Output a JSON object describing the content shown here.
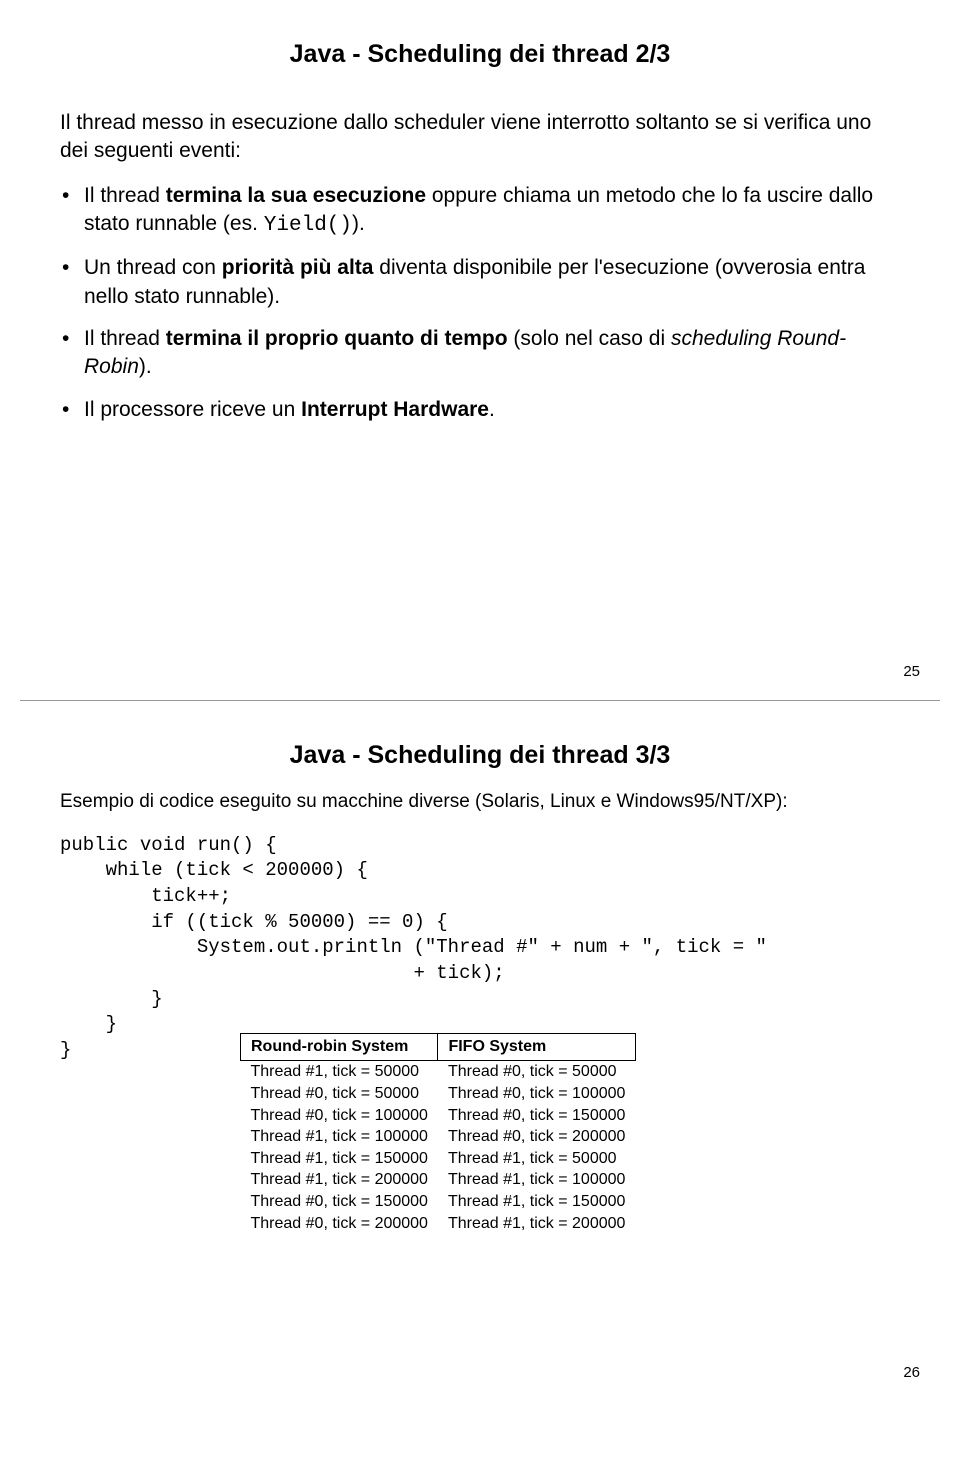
{
  "slide1": {
    "title": "Java - Scheduling dei thread 2/3",
    "intro": "Il thread messo in esecuzione dallo scheduler viene interrotto soltanto se si verifica uno dei seguenti eventi:",
    "b1a": "Il thread ",
    "b1b": "termina la sua esecuzione",
    "b1c": " oppure chiama un metodo che lo fa uscire dallo stato runnable (es. ",
    "b1d": "Yield()",
    "b1e": ").",
    "b2a": "Un thread con ",
    "b2b": "priorità più alta",
    "b2c": " diventa disponibile per l'esecuzione (ovverosia entra nello stato runnable).",
    "b3a": "Il thread ",
    "b3b": "termina il proprio quanto di tempo",
    "b3c": " (solo nel caso di ",
    "b3d": "scheduling Round-Robin",
    "b3e": ").",
    "b4a": "Il processore riceve un ",
    "b4b": "Interrupt Hardware",
    "b4c": ".",
    "pagenum": "25"
  },
  "slide2": {
    "title": "Java - Scheduling dei thread 3/3",
    "example": "Esempio di codice eseguito su macchine diverse (Solaris, Linux e Windows95/NT/XP):",
    "code": "public void run() {\n    while (tick < 200000) {\n        tick++;\n        if ((tick % 50000) == 0) {\n            System.out.println (\"Thread #\" + num + \", tick = \"\n                               + tick);\n        }\n    }\n}",
    "th1": "Round-robin System",
    "th2": "FIFO System",
    "rr": [
      "Thread #1, tick = 50000",
      "Thread #0, tick = 50000",
      "Thread #0, tick = 100000",
      "Thread #1, tick = 100000",
      "Thread #1, tick = 150000",
      "Thread #1, tick = 200000",
      "Thread #0, tick = 150000",
      "Thread #0, tick = 200000"
    ],
    "fifo": [
      "Thread #0, tick = 50000",
      "Thread #0, tick = 100000",
      "Thread #0, tick = 150000",
      "Thread #0, tick = 200000",
      "Thread #1, tick = 50000",
      "Thread #1, tick = 100000",
      "Thread #1, tick = 150000",
      "Thread #1, tick = 200000"
    ],
    "pagenum": "26"
  },
  "chart_data": {
    "type": "table",
    "title": "Thread scheduling output comparison",
    "columns": [
      "Round-robin System",
      "FIFO System"
    ],
    "rows": [
      [
        "Thread #1, tick = 50000",
        "Thread #0, tick = 50000"
      ],
      [
        "Thread #0, tick = 50000",
        "Thread #0, tick = 100000"
      ],
      [
        "Thread #0, tick = 100000",
        "Thread #0, tick = 150000"
      ],
      [
        "Thread #1, tick = 100000",
        "Thread #0, tick = 200000"
      ],
      [
        "Thread #1, tick = 150000",
        "Thread #1, tick = 50000"
      ],
      [
        "Thread #1, tick = 200000",
        "Thread #1, tick = 100000"
      ],
      [
        "Thread #0, tick = 150000",
        "Thread #1, tick = 150000"
      ],
      [
        "Thread #0, tick = 200000",
        "Thread #1, tick = 200000"
      ]
    ]
  }
}
